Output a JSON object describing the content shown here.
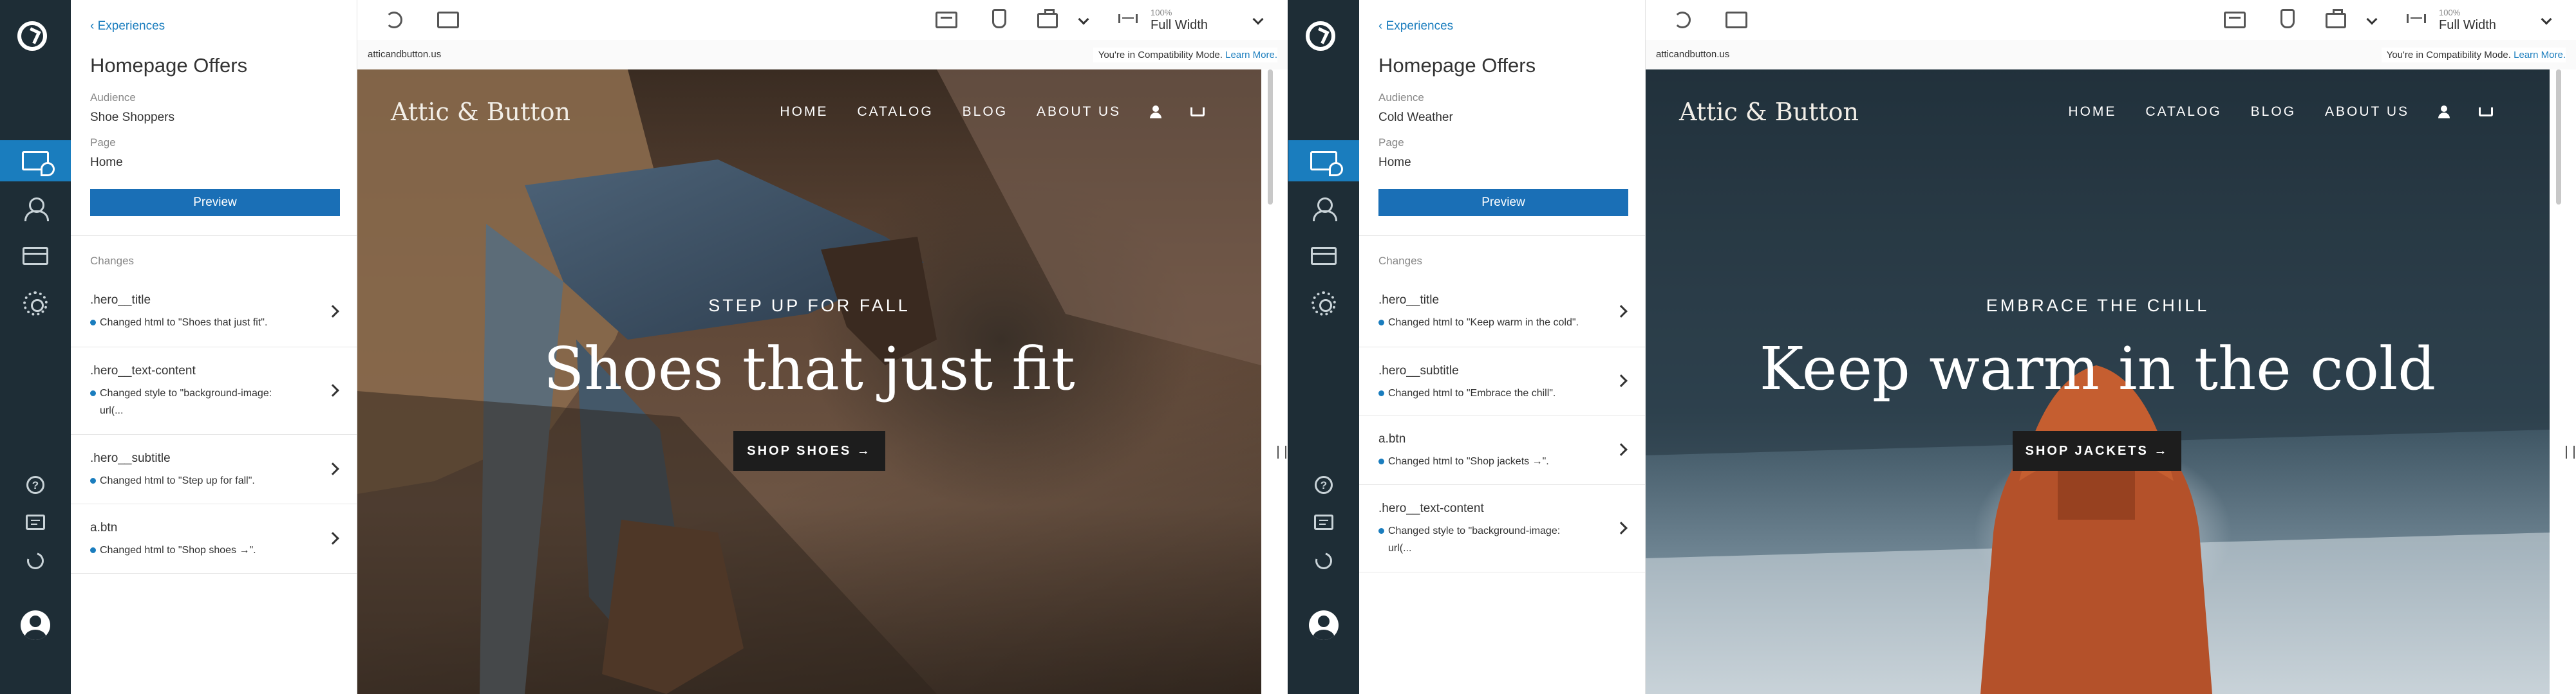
{
  "panels": [
    {
      "sidebar": {
        "back_label": "Experiences",
        "title": "Homepage Offers",
        "audience_label": "Audience",
        "audience_value": "Shoe Shoppers",
        "page_label": "Page",
        "page_value": "Home",
        "preview_label": "Preview",
        "changes_heading": "Changes",
        "changes": [
          {
            "selector": ".hero__title",
            "description": "Changed html to \"Shoes that just fit\"."
          },
          {
            "selector": ".hero__text-content",
            "description": "Changed style to \"background-image: url(..."
          },
          {
            "selector": ".hero__subtitle",
            "description": "Changed html to \"Step up for fall\"."
          },
          {
            "selector": "a.btn",
            "description": "Changed html to \"Shop shoes →\"."
          }
        ]
      },
      "toolbar": {
        "zoom": "100%",
        "width_mode": "Full Width"
      },
      "url_bar": {
        "url": "atticandbutton.us",
        "compat_text": "You're in Compatibility Mode.",
        "learn_more": "Learn More."
      },
      "site": {
        "brand": "Attic & Button",
        "nav": [
          "HOME",
          "CATALOG",
          "BLOG",
          "ABOUT US"
        ],
        "eyebrow": "STEP UP FOR FALL",
        "headline": "Shoes that just fit",
        "cta": "SHOP SHOES →"
      }
    },
    {
      "sidebar": {
        "back_label": "Experiences",
        "title": "Homepage Offers",
        "audience_label": "Audience",
        "audience_value": "Cold Weather",
        "page_label": "Page",
        "page_value": "Home",
        "preview_label": "Preview",
        "changes_heading": "Changes",
        "changes": [
          {
            "selector": ".hero__title",
            "description": "Changed html to \"Keep warm in the cold\"."
          },
          {
            "selector": ".hero__subtitle",
            "description": "Changed html to \"Embrace the chill\"."
          },
          {
            "selector": "a.btn",
            "description": "Changed html to \"Shop jackets →\"."
          },
          {
            "selector": ".hero__text-content",
            "description": "Changed style to \"background-image: url(..."
          }
        ]
      },
      "toolbar": {
        "zoom": "100%",
        "width_mode": "Full Width"
      },
      "url_bar": {
        "url": "atticandbutton.us",
        "compat_text": "You're in Compatibility Mode.",
        "learn_more": "Learn More."
      },
      "site": {
        "brand": "Attic & Button",
        "nav": [
          "HOME",
          "CATALOG",
          "BLOG",
          "ABOUT US"
        ],
        "eyebrow": "EMBRACE THE CHILL",
        "headline": "Keep warm in the cold",
        "cta": "SHOP JACKETS →"
      }
    }
  ],
  "colors": {
    "accent": "#1a7dbe",
    "rail": "#1e2d36",
    "button": "#1a6fb6",
    "cta_bg": "#1d1d1d"
  },
  "icons": [
    "app-logo-icon",
    "experiences-icon",
    "audiences-icon",
    "pages-icon",
    "settings-icon",
    "help-icon",
    "chat-icon",
    "redo-icon",
    "user-avatar-icon",
    "undo-icon",
    "image-icon",
    "layout-icon",
    "select-hand-icon",
    "briefcase-icon",
    "width-icon",
    "chevron-down-icon",
    "chevron-right-icon",
    "user-icon",
    "cart-icon"
  ]
}
